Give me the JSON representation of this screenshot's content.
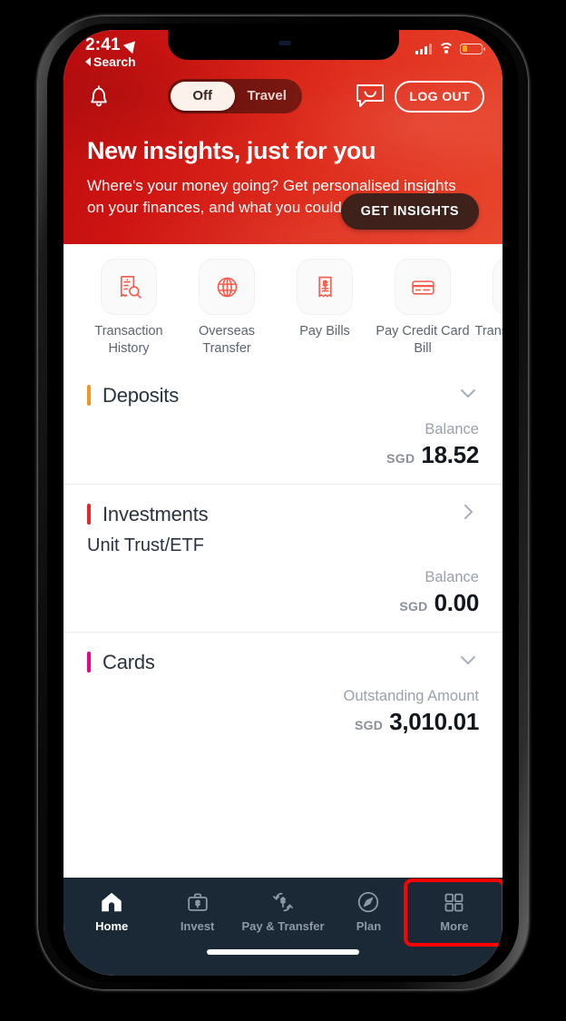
{
  "status_bar": {
    "time": "2:41",
    "back_label": "Search",
    "location_icon": "location-arrow-icon",
    "signal_icon": "cellular-signal-icon",
    "wifi_icon": "wifi-icon",
    "battery_icon": "battery-low-icon"
  },
  "top_bar": {
    "bell_icon": "notification-bell-icon",
    "chat_icon": "chat-bubble-icon",
    "logout_label": "LOG OUT",
    "toggle": {
      "options": [
        "Off",
        "Travel"
      ],
      "selected": "Off"
    }
  },
  "banner": {
    "title": "New insights, just for you",
    "body": "Where's your money going? Get personalised insights on your finances, and what you could be doing next.",
    "cta_label": "GET INSIGHTS"
  },
  "quick_actions": [
    {
      "label": "Transaction History",
      "icon": "receipt-search-icon"
    },
    {
      "label": "Overseas Transfer",
      "icon": "globe-icon"
    },
    {
      "label": "Pay Bills",
      "icon": "bill-receipt-icon"
    },
    {
      "label": "Pay Credit Card Bill",
      "icon": "credit-card-icon"
    },
    {
      "label": "Transfer Money",
      "icon": "transfer-money-icon"
    }
  ],
  "accounts": [
    {
      "title": "Deposits",
      "subtitle": "",
      "accent": "#f7941e",
      "chevron": "chevron-down-icon",
      "amount_label": "Balance",
      "currency": "SGD",
      "value": "18.52"
    },
    {
      "title": "Investments",
      "subtitle": "Unit Trust/ETF",
      "accent": "#e8252a",
      "chevron": "chevron-right-icon",
      "amount_label": "Balance",
      "currency": "SGD",
      "value": "0.00"
    },
    {
      "title": "Cards",
      "subtitle": "",
      "accent": "#ec008c",
      "chevron": "chevron-down-icon",
      "amount_label": "Outstanding Amount",
      "currency": "SGD",
      "value": "3,010.01"
    }
  ],
  "bottom_nav": [
    {
      "label": "Home",
      "icon": "home-icon",
      "active": true,
      "highlighted": false
    },
    {
      "label": "Invest",
      "icon": "briefcase-dollar-icon",
      "active": false,
      "highlighted": false
    },
    {
      "label": "Pay & Transfer",
      "icon": "transfer-arrows-dollar-icon",
      "active": false,
      "highlighted": false
    },
    {
      "label": "Plan",
      "icon": "compass-icon",
      "active": false,
      "highlighted": false
    },
    {
      "label": "More",
      "icon": "grid-squares-icon",
      "active": false,
      "highlighted": true
    }
  ],
  "colors": {
    "brand_red": "#e0301f",
    "nav_dark": "#1b2836",
    "highlight": "#ff0000"
  }
}
